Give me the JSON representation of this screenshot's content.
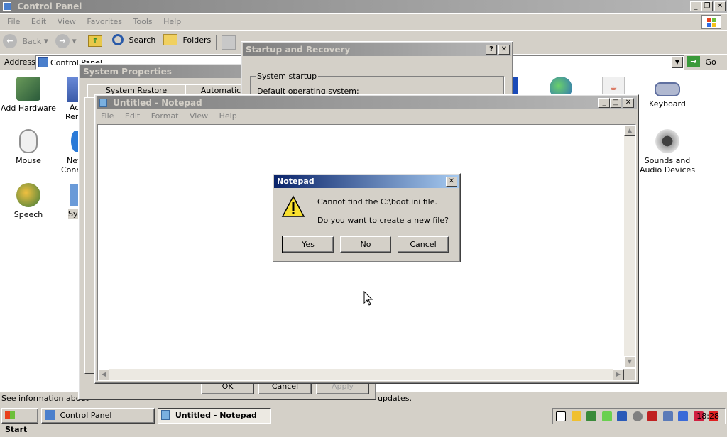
{
  "control_panel": {
    "title": "Control Panel",
    "menu": [
      "File",
      "Edit",
      "View",
      "Favorites",
      "Tools",
      "Help"
    ],
    "toolbar": {
      "back": "Back",
      "search": "Search",
      "folders": "Folders"
    },
    "address_label": "Address",
    "address_value": "Control Panel",
    "go_label": "Go",
    "icons": {
      "add_hardware": "Add Hardware",
      "mouse": "Mouse",
      "speech": "Speech",
      "keyboard": "Keyboard",
      "sounds": "Sounds and Audio Devices",
      "partial_ac": "Ac",
      "partial_rem": "Rem",
      "partial_net": "Net",
      "partial_conn": "Conn",
      "partial_sy": "Sy"
    },
    "status_text": "See information about",
    "status_text_right": "updates."
  },
  "system_properties": {
    "title": "System Properties",
    "tab_system_restore": "System Restore",
    "tab_automatic": "Automatic",
    "ok_label": "OK",
    "cancel_label": "Cancel",
    "apply_label": "Apply"
  },
  "startup_recovery": {
    "title": "Startup and Recovery",
    "group_label": "System startup",
    "default_os_label": "Default operating system:"
  },
  "notepad": {
    "title": "Untitled - Notepad",
    "menu": [
      "File",
      "Edit",
      "Format",
      "View",
      "Help"
    ]
  },
  "dialog": {
    "title": "Notepad",
    "line1": "Cannot find the C:\\boot.ini file.",
    "line2": "Do you want to create a new file?",
    "yes": "Yes",
    "no": "No",
    "cancel": "Cancel"
  },
  "taskbar": {
    "start": "Start",
    "task_control_panel": "Control Panel",
    "task_notepad": "Untitled - Notepad",
    "clock": "18:28"
  },
  "colors": {
    "active_title": "#0a246a",
    "inactive_title": "#808080",
    "face": "#d4d0c8"
  }
}
